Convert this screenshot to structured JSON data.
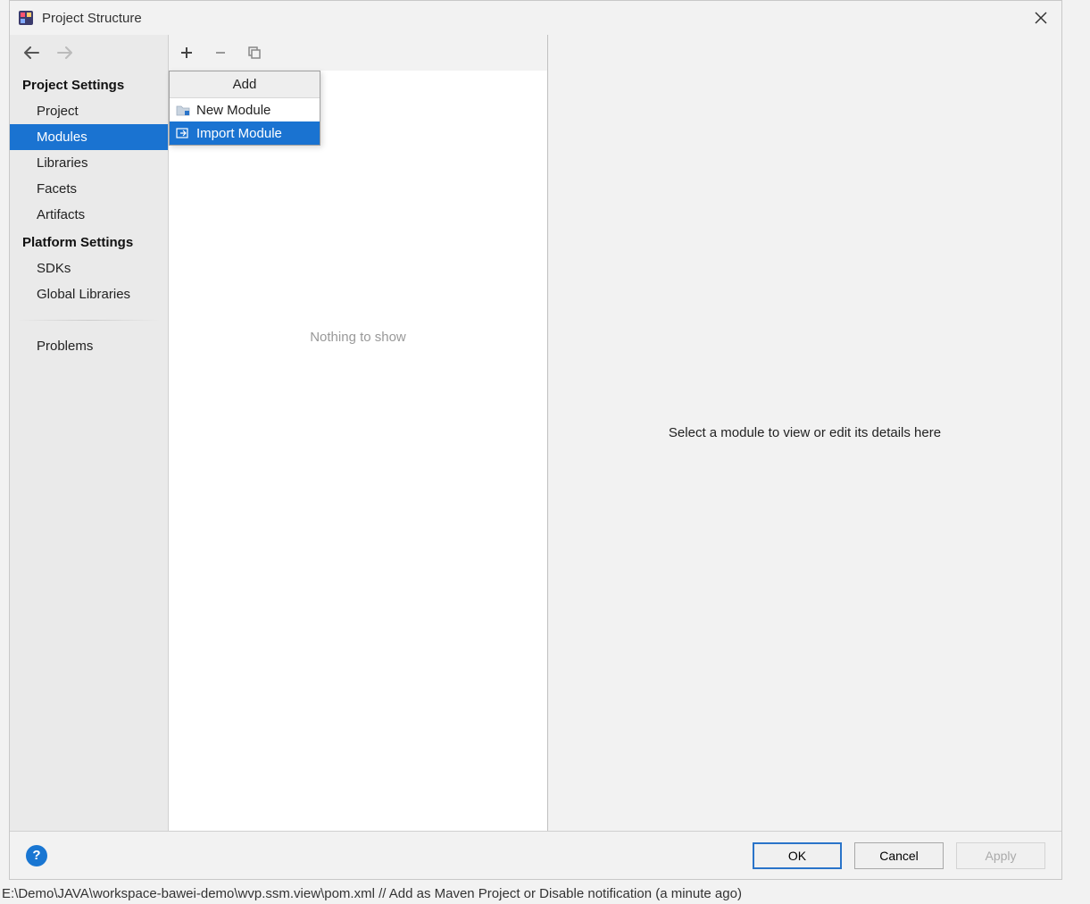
{
  "titlebar": {
    "title": "Project Structure"
  },
  "sidebar": {
    "section1_header": "Project Settings",
    "items1": [
      "Project",
      "Modules",
      "Libraries",
      "Facets",
      "Artifacts"
    ],
    "selected1": "Modules",
    "section2_header": "Platform Settings",
    "items2": [
      "SDKs",
      "Global Libraries"
    ],
    "section3_items": [
      "Problems"
    ]
  },
  "dropdown": {
    "header": "Add",
    "items": [
      {
        "label": "New Module",
        "selected": false
      },
      {
        "label": "Import Module",
        "selected": true
      }
    ]
  },
  "middle": {
    "empty_text": "Nothing to show"
  },
  "right": {
    "hint": "Select a module to view or edit its details here"
  },
  "footer": {
    "ok": "OK",
    "cancel": "Cancel",
    "apply": "Apply"
  },
  "statusbar": {
    "text": "E:\\Demo\\JAVA\\workspace-bawei-demo\\wvp.ssm.view\\pom.xml // Add as Maven Project or Disable notification (a minute ago)"
  }
}
